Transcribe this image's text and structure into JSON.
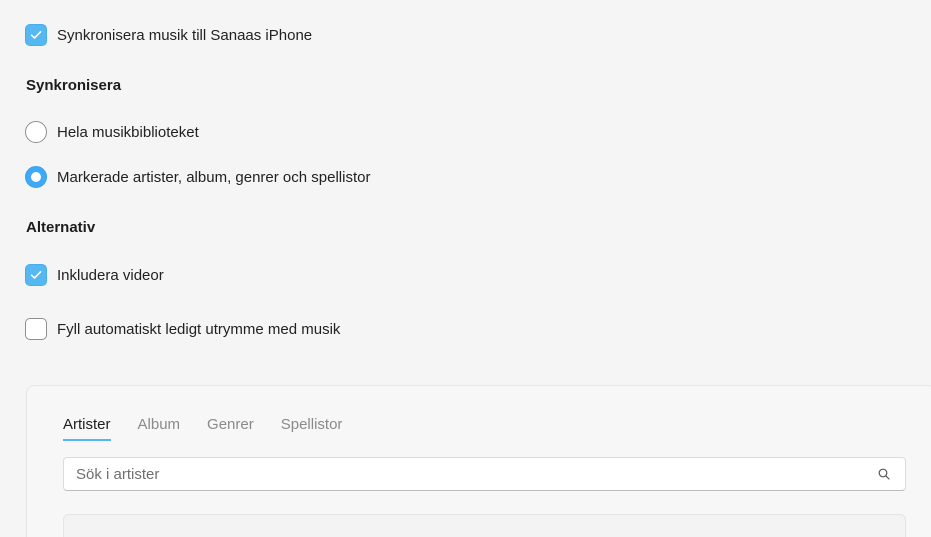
{
  "sync_music": {
    "label": "Synkronisera musik till Sanaas iPhone",
    "checked": true
  },
  "sync_section": {
    "heading": "Synkronisera",
    "options": [
      {
        "label": "Hela musikbiblioteket",
        "selected": false
      },
      {
        "label": "Markerade artister, album, genrer och spellistor",
        "selected": true
      }
    ]
  },
  "alternatives": {
    "heading": "Alternativ",
    "include_videos": {
      "label": "Inkludera videor",
      "checked": true
    },
    "autofill": {
      "label": "Fyll automatiskt ledigt utrymme med musik",
      "checked": false
    }
  },
  "browser": {
    "tabs": [
      {
        "label": "Artister",
        "active": true
      },
      {
        "label": "Album",
        "active": false
      },
      {
        "label": "Genrer",
        "active": false
      },
      {
        "label": "Spellistor",
        "active": false
      }
    ],
    "search": {
      "placeholder": "Sök i artister",
      "value": "",
      "icon": "search-icon"
    }
  },
  "colors": {
    "accent": "#56b8f1",
    "radio_selected": "#3fa9f5",
    "background": "#f5f5f5"
  }
}
